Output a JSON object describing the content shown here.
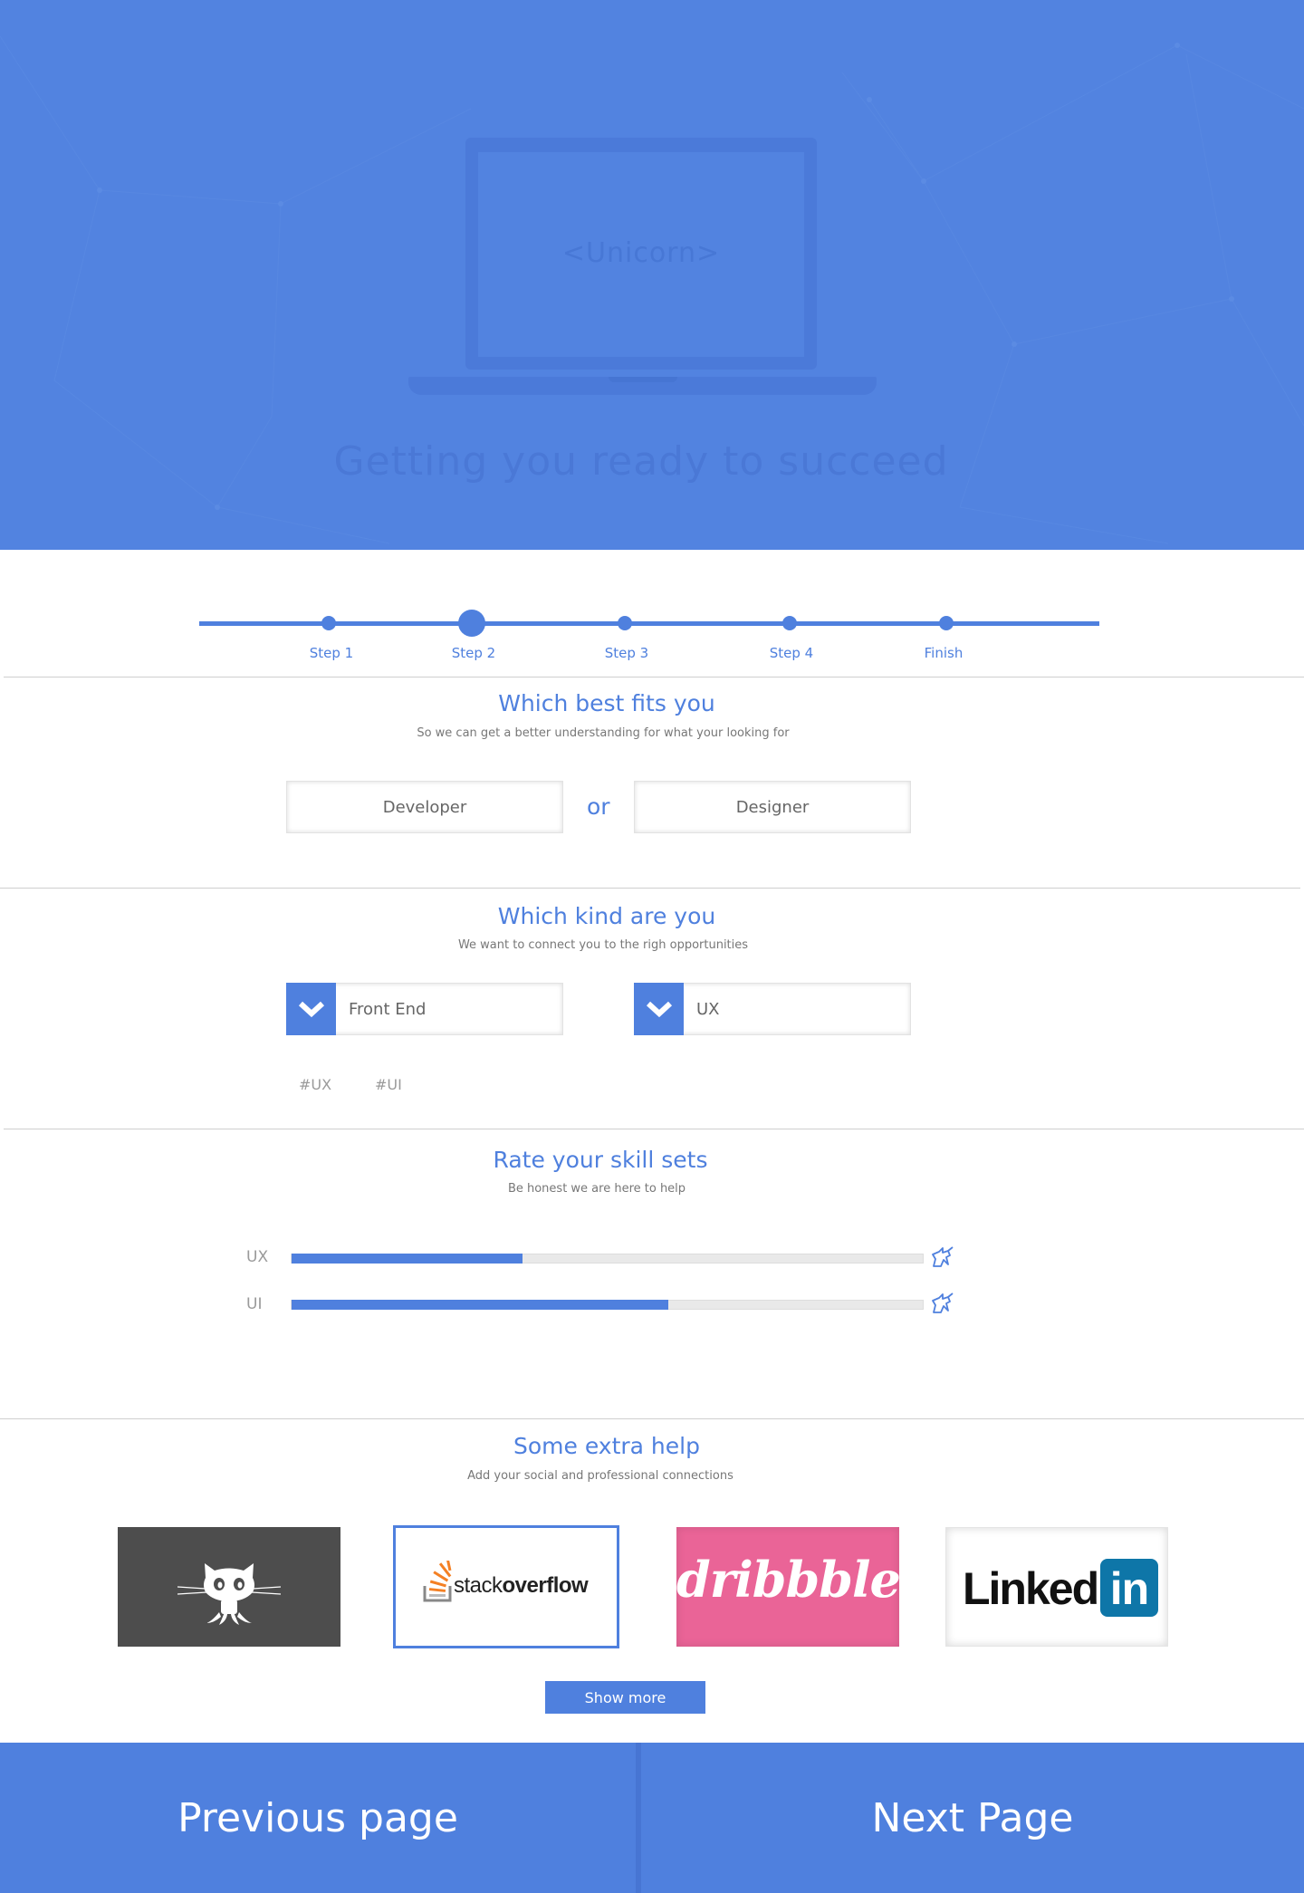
{
  "hero": {
    "laptop_text": "<Unicorn>",
    "title": "Getting you ready to succeed"
  },
  "steps": [
    {
      "label": "Step 1"
    },
    {
      "label": "Step 2",
      "current": true
    },
    {
      "label": "Step 3"
    },
    {
      "label": "Step 4"
    },
    {
      "label": "Finish"
    }
  ],
  "role_section": {
    "title": "Which best fits you",
    "subtitle": "So we can get a better understanding for what your looking for",
    "option_a": "Developer",
    "or_label": "or",
    "option_b": "Designer"
  },
  "kind_section": {
    "title": "Which kind are you",
    "subtitle": "We want to connect you to the righ opportunities",
    "select_a": {
      "value": "Front End",
      "icon": "chevron-down-icon"
    },
    "select_b": {
      "value": "UX",
      "icon": "chevron-down-icon"
    },
    "tags": [
      "#UX",
      "#UI"
    ]
  },
  "skills_section": {
    "title": "Rate your skill sets",
    "subtitle": "Be honest we are here to help",
    "skills": [
      {
        "label": "UX",
        "level": 0.366,
        "icon": "unicorn-icon"
      },
      {
        "label": "UI",
        "level": 0.597,
        "icon": "unicorn-icon"
      }
    ]
  },
  "social_section": {
    "title": "Some extra help",
    "subtitle": "Add your social and professional connections",
    "cards": [
      {
        "name": "github",
        "icon": "github-octocat-icon"
      },
      {
        "name": "stackoverflow",
        "text_light": "stack",
        "text_bold": "overflow",
        "selected": true
      },
      {
        "name": "dribbble",
        "text": "dribbble"
      },
      {
        "name": "linkedin",
        "text": "Linked",
        "badge": "in"
      }
    ],
    "show_more": "Show more"
  },
  "nav": {
    "previous": "Previous page",
    "next": "Next Page"
  },
  "colors": {
    "accent": "#4f80de",
    "hero_bg": "#5283e0",
    "github_bg": "#4d4d4d",
    "dribbble_bg": "#ea6497",
    "linkedin_blue": "#0e76a8"
  }
}
